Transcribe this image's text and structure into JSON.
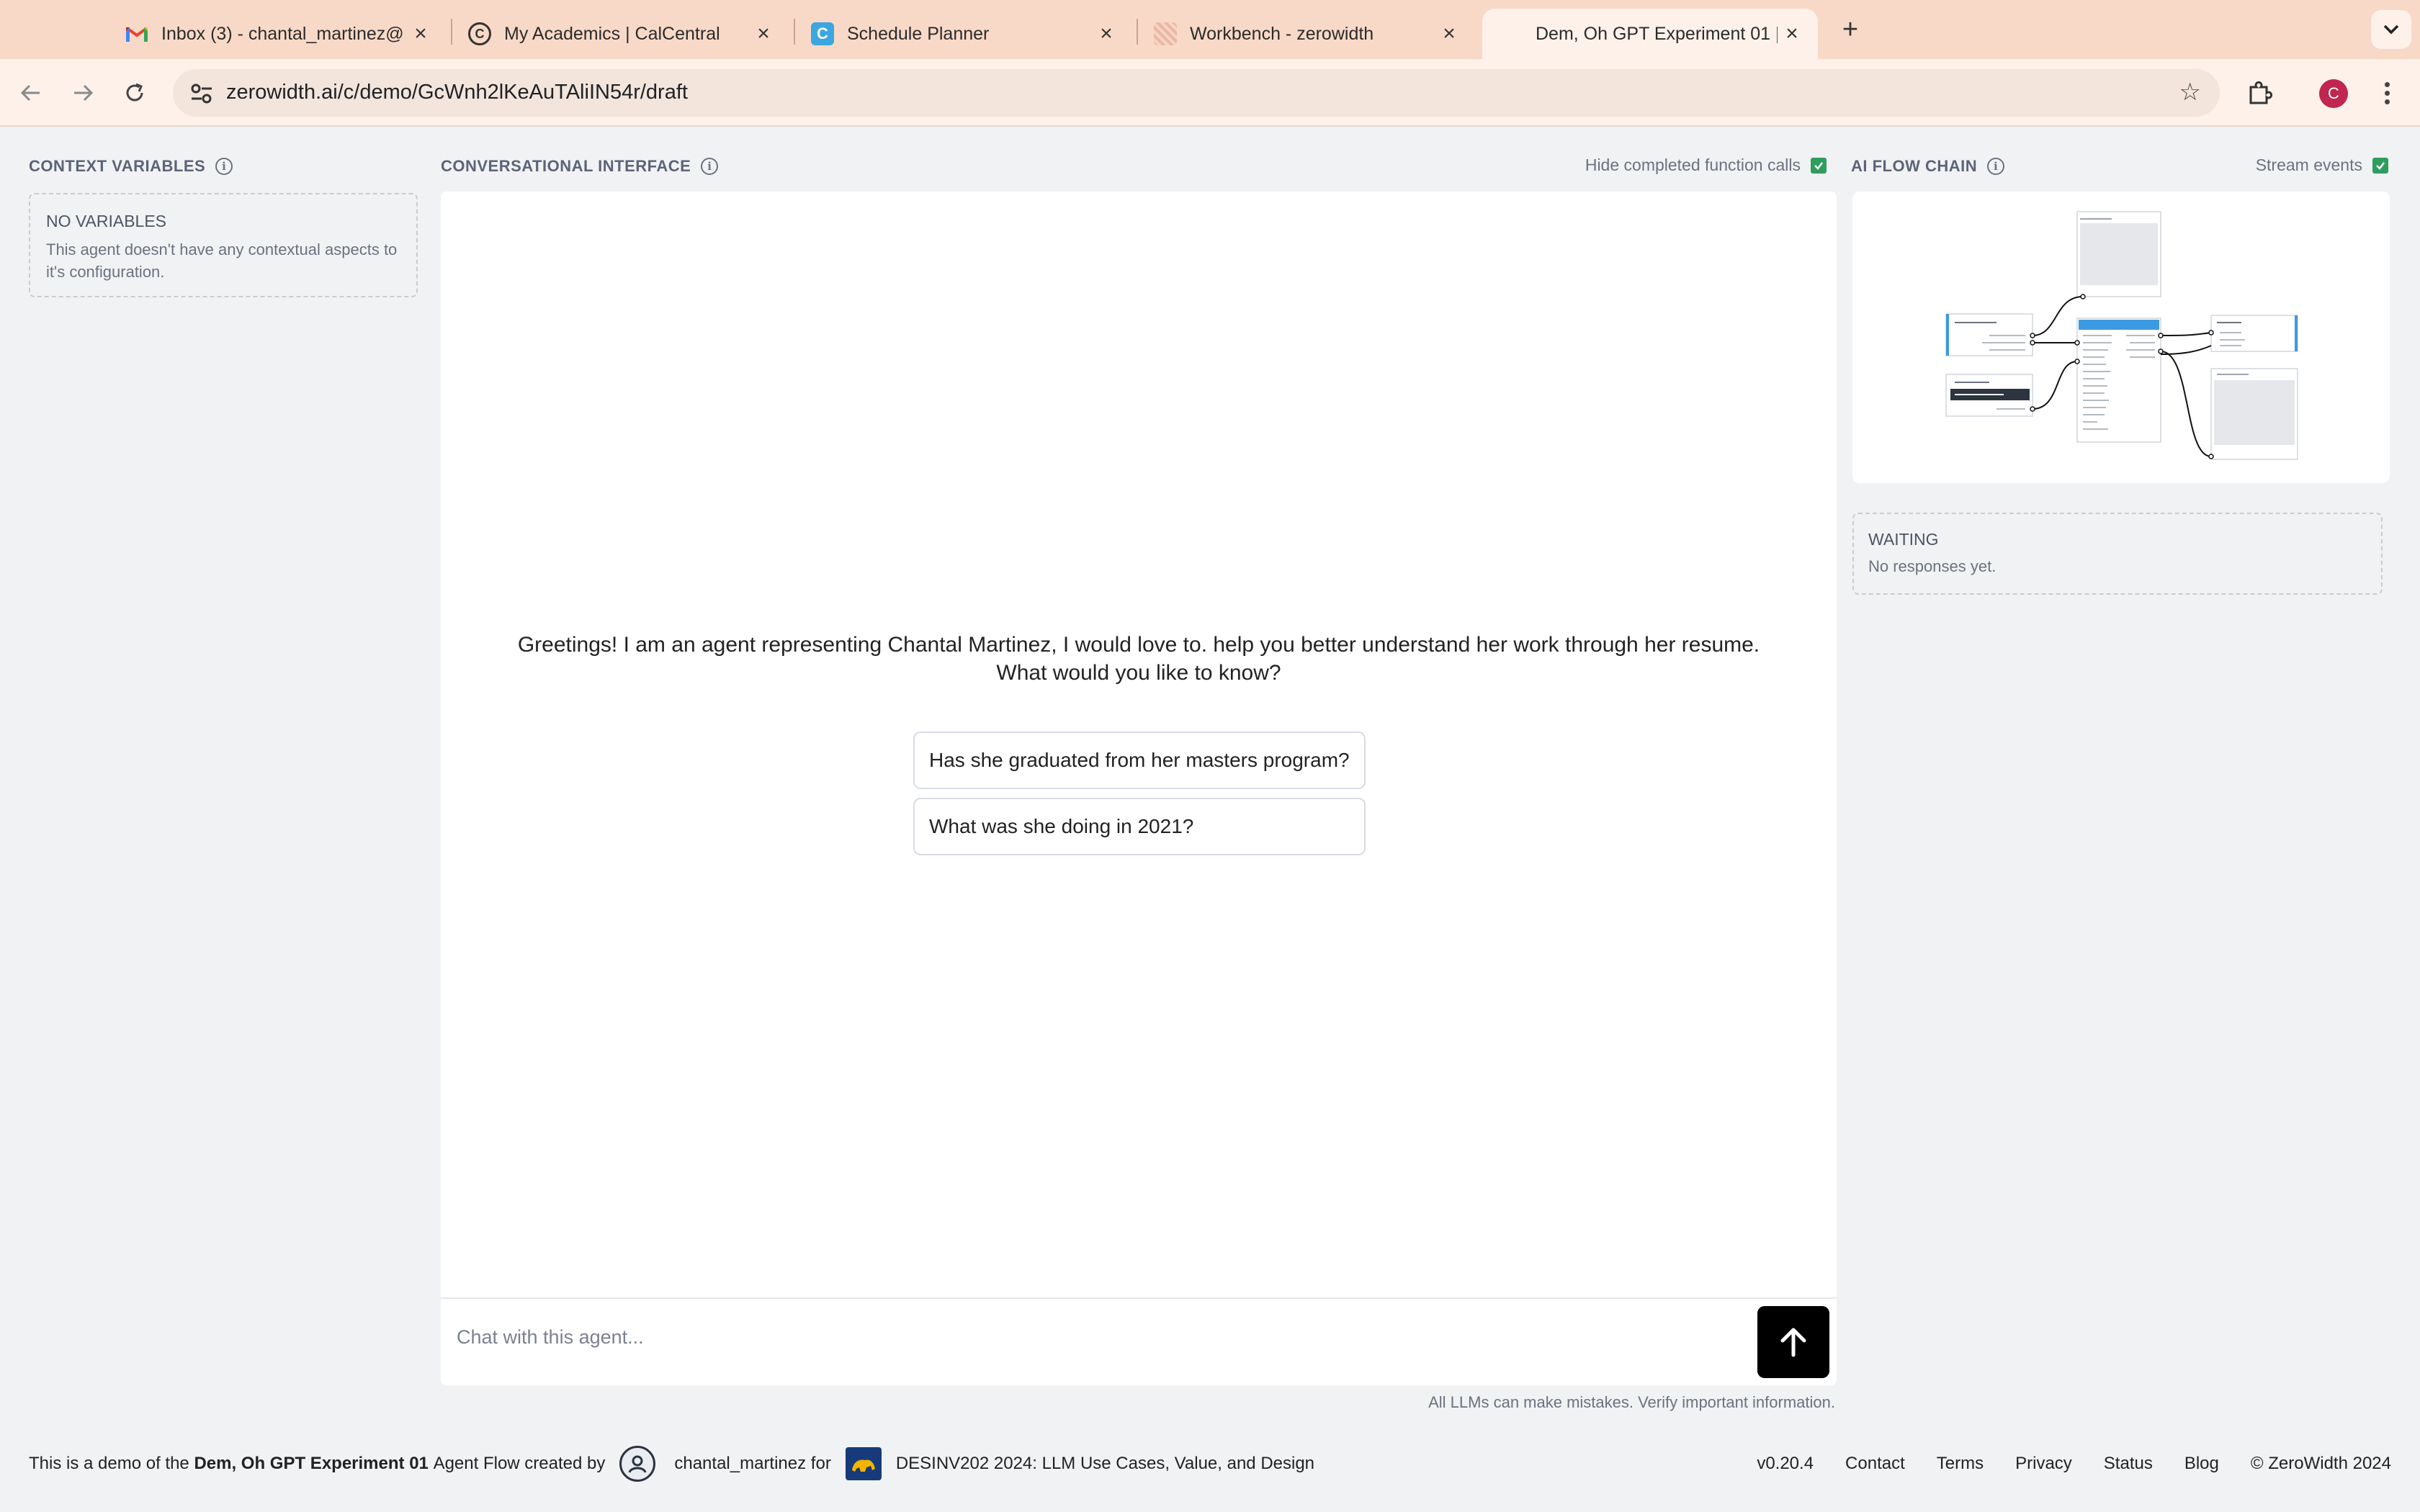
{
  "browser": {
    "tabs": [
      {
        "title": "Inbox (3) - chantal_martinez@",
        "icon": "gmail-icon"
      },
      {
        "title": "My Academics | CalCentral",
        "icon": "calcentral-icon"
      },
      {
        "title": "Schedule Planner",
        "icon": "schedule-planner-icon"
      },
      {
        "title": "Workbench - zerowidth",
        "icon": "zerowidth-icon"
      },
      {
        "title": "Dem, Oh GPT Experiment 01 |",
        "icon": "blank-page-icon",
        "active": true
      }
    ],
    "url": "zerowidth.ai/c/demo/GcWnh2lKeAuTAliIN54r/draft",
    "profile_initial": "C"
  },
  "context_variables": {
    "title": "CONTEXT VARIABLES",
    "empty_heading": "NO VARIABLES",
    "empty_text": "This agent doesn't have any contextual aspects to it's configuration."
  },
  "conversation": {
    "title": "CONVERSATIONAL INTERFACE",
    "hide_completed_label": "Hide completed function calls",
    "hide_completed_checked": true,
    "greeting": "Greetings! I am an agent representing Chantal Martinez, I would love to. help you better understand her work through her resume. What would you like to know?",
    "suggestions": [
      "Has she graduated from her masters program?",
      "What was she doing in 2021?"
    ],
    "input_placeholder": "Chat with this agent...",
    "disclaimer": "All LLMs can make mistakes. Verify important information."
  },
  "ai_flow": {
    "title": "AI FLOW CHAIN",
    "stream_events_label": "Stream events",
    "stream_events_checked": true,
    "status_heading": "WAITING",
    "status_text": "No responses yet."
  },
  "footer": {
    "prefix": "This is a demo of the",
    "agent_name": "Dem, Oh GPT Experiment 01",
    "middle": "Agent Flow created by",
    "username": "chantal_martinez",
    "for_word": "for",
    "org": "DESINV202 2024: LLM Use Cases, Value, and Design",
    "links": [
      "v0.20.4",
      "Contact",
      "Terms",
      "Privacy",
      "Status",
      "Blog",
      "© ZeroWidth 2024"
    ]
  },
  "colors": {
    "tab_strip": "#f8d9c7",
    "toolbar": "#fdf1ea",
    "checkbox": "#2e9e5f",
    "send_button": "#000000",
    "profile": "#c0264f"
  }
}
